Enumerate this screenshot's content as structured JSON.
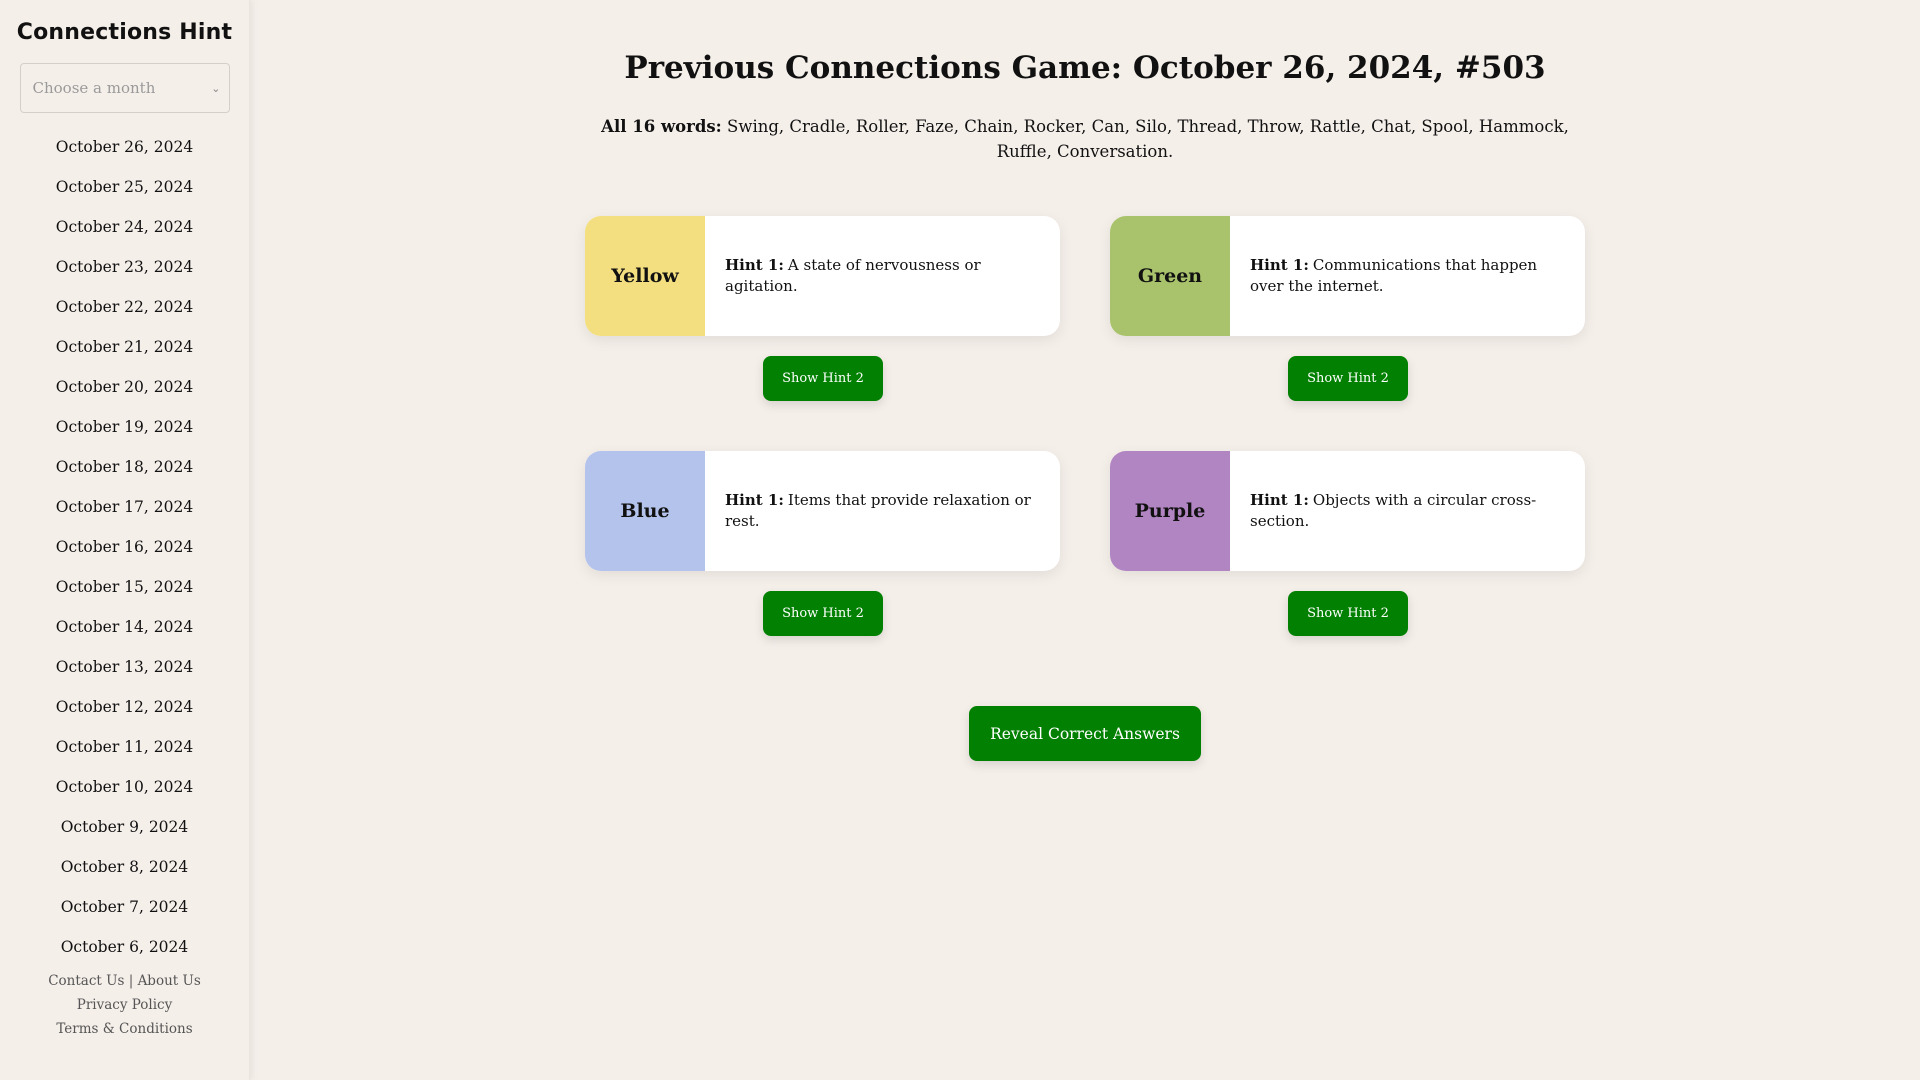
{
  "sidebar": {
    "title": "Connections Hint",
    "month_select": {
      "placeholder": "Choose a month"
    },
    "dates": [
      "October 26, 2024",
      "October 25, 2024",
      "October 24, 2024",
      "October 23, 2024",
      "October 22, 2024",
      "October 21, 2024",
      "October 20, 2024",
      "October 19, 2024",
      "October 18, 2024",
      "October 17, 2024",
      "October 16, 2024",
      "October 15, 2024",
      "October 14, 2024",
      "October 13, 2024",
      "October 12, 2024",
      "October 11, 2024",
      "October 10, 2024",
      "October 9, 2024",
      "October 8, 2024",
      "October 7, 2024",
      "October 6, 2024"
    ],
    "footer": {
      "contact": "Contact Us",
      "separator": "|",
      "about": "About Us",
      "privacy": "Privacy Policy",
      "terms": "Terms & Conditions"
    }
  },
  "main": {
    "title": "Previous Connections Game: October 26, 2024, #503",
    "words_label": "All 16 words:",
    "words_text": "Swing, Cradle, Roller, Faze, Chain, Rocker, Can, Silo, Thread, Throw, Rattle, Chat, Spool, Hammock, Ruffle, Conversation.",
    "hint_label": "Hint 1:",
    "show_hint_label": "Show Hint 2",
    "reveal_label": "Reveal Correct Answers",
    "groups": [
      {
        "color_name": "Yellow",
        "color": "#f4df80",
        "hint": "A state of nervousness or agitation."
      },
      {
        "color_name": "Green",
        "color": "#a9c36c",
        "hint": "Communications that happen over the internet."
      },
      {
        "color_name": "Blue",
        "color": "#b4c3ec",
        "hint": "Items that provide relaxation or rest."
      },
      {
        "color_name": "Purple",
        "color": "#b184c2",
        "hint": "Objects with a circular cross-section."
      }
    ],
    "button_color": "#028002"
  }
}
